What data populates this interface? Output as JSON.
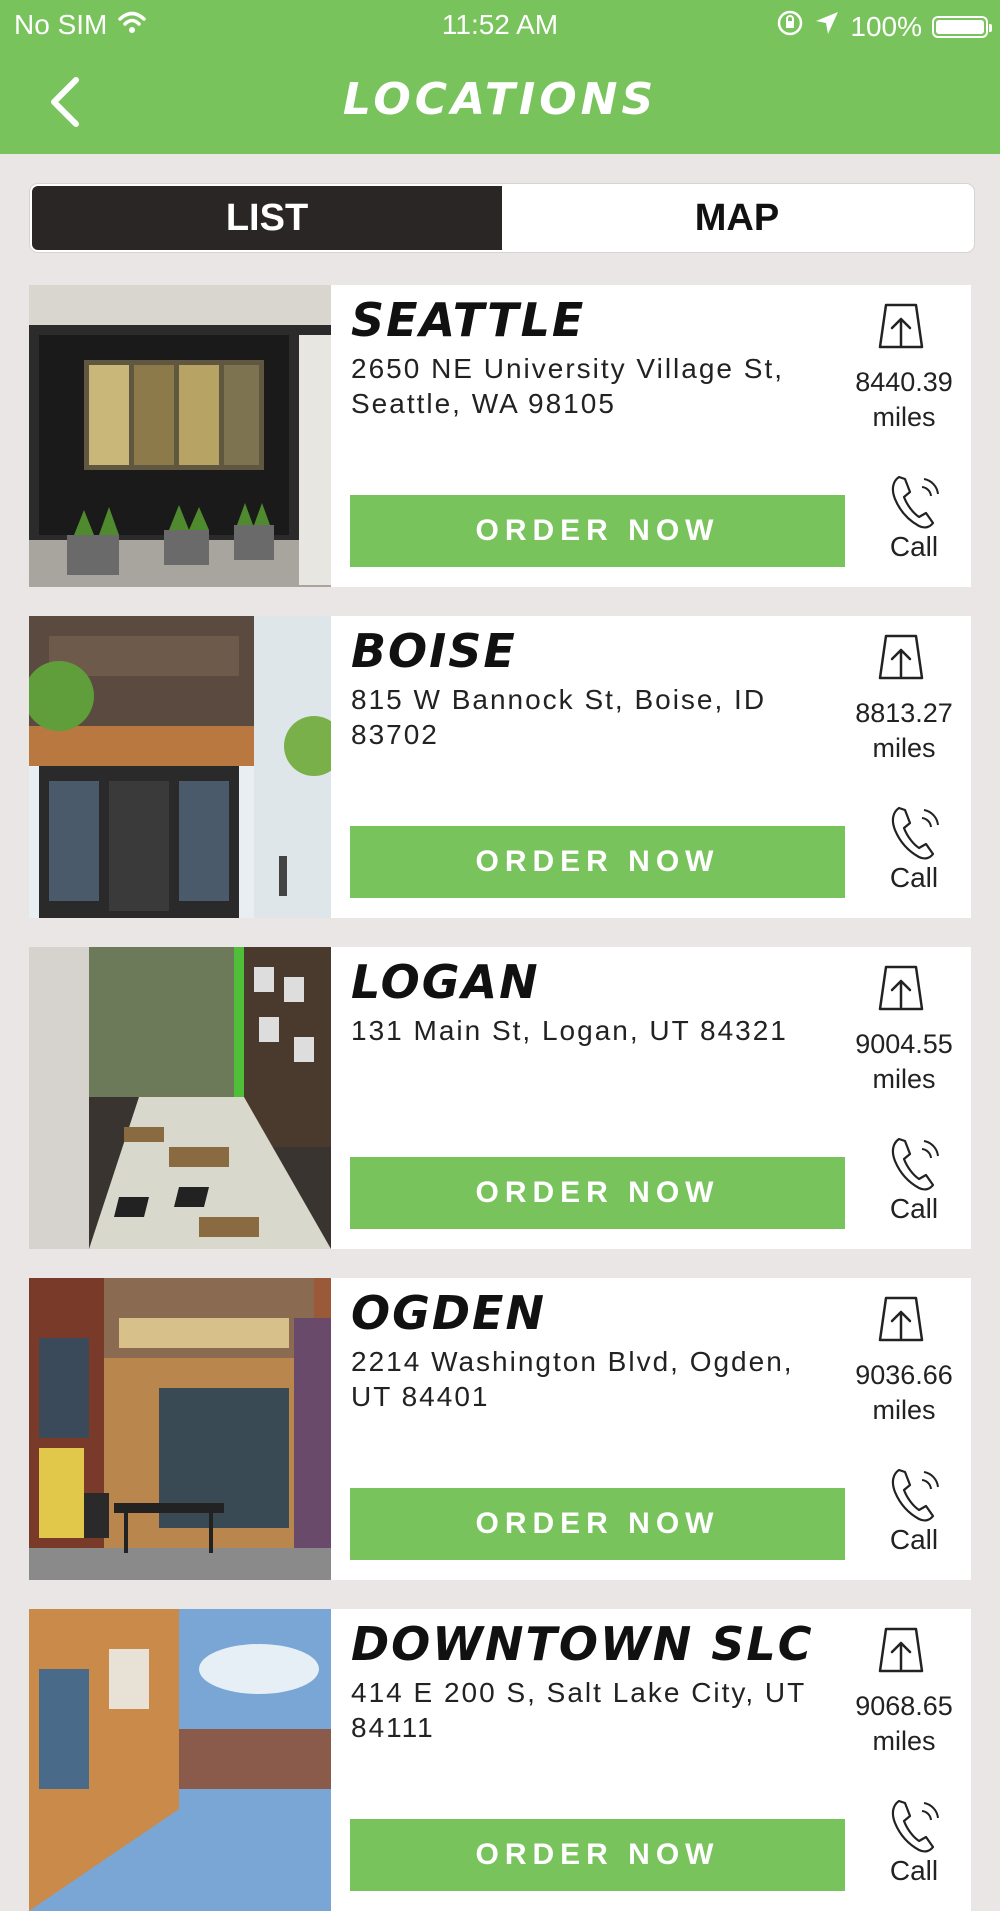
{
  "status_bar": {
    "carrier": "No SIM",
    "time": "11:52 AM",
    "battery": "100%"
  },
  "nav": {
    "title": "LOCATIONS"
  },
  "tabs": [
    {
      "label": "LIST",
      "active": true
    },
    {
      "label": "MAP",
      "active": false
    }
  ],
  "colors": {
    "brand_green": "#79c35d",
    "dark": "#2a2626",
    "background": "#ebe6e6"
  },
  "locations": [
    {
      "city": "SEATTLE",
      "address": "2650 NE University Village St, Seattle, WA 98105",
      "distance": "8440.39",
      "unit": "miles",
      "order_label": "ORDER NOW",
      "call_label": "Call"
    },
    {
      "city": "BOISE",
      "address": "815 W Bannock St, Boise, ID 83702",
      "distance": "8813.27",
      "unit": "miles",
      "order_label": "ORDER NOW",
      "call_label": "Call"
    },
    {
      "city": "LOGAN",
      "address": "131 Main St, Logan, UT 84321",
      "distance": "9004.55",
      "unit": "miles",
      "order_label": "ORDER NOW",
      "call_label": "Call"
    },
    {
      "city": "OGDEN",
      "address": "2214 Washington Blvd, Ogden, UT 84401",
      "distance": "9036.66",
      "unit": "miles",
      "order_label": "ORDER NOW",
      "call_label": "Call"
    },
    {
      "city": "DOWNTOWN SLC",
      "address": "414 E 200 S, Salt Lake City, UT 84111",
      "distance": "9068.65",
      "unit": "miles",
      "order_label": "ORDER NOW",
      "call_label": "Call"
    }
  ]
}
